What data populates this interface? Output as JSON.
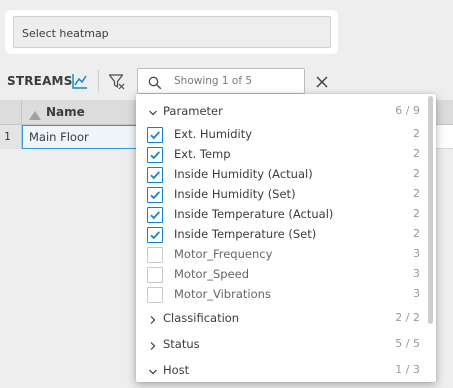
{
  "heatmap": {
    "placeholder": "Select heatmap"
  },
  "toolbar": {
    "streams_label": "STREAMS",
    "chart_icon": "line-chart-icon",
    "filter_icon": "filter-icon",
    "search_placeholder": "Showing 1 of 5",
    "close_icon": "close-icon"
  },
  "grid": {
    "column_name": "Name",
    "rows": [
      {
        "num": "1",
        "name": "Main Floor"
      }
    ]
  },
  "dropdown": {
    "groups": [
      {
        "label": "Parameter",
        "count": "6 / 9",
        "expanded": true,
        "options": [
          {
            "label": "Ext. Humidity",
            "count": "2",
            "checked": true
          },
          {
            "label": "Ext. Temp",
            "count": "2",
            "checked": true
          },
          {
            "label": "Inside Humidity (Actual)",
            "count": "2",
            "checked": true
          },
          {
            "label": "Inside Humidity (Set)",
            "count": "2",
            "checked": true
          },
          {
            "label": "Inside Temperature (Actual)",
            "count": "2",
            "checked": true
          },
          {
            "label": "Inside Temperature (Set)",
            "count": "2",
            "checked": true
          },
          {
            "label": "Motor_Frequency",
            "count": "3",
            "checked": false
          },
          {
            "label": "Motor_Speed",
            "count": "3",
            "checked": false
          },
          {
            "label": "Motor_Vibrations",
            "count": "3",
            "checked": false
          }
        ]
      },
      {
        "label": "Classification",
        "count": "2 / 2",
        "expanded": false
      },
      {
        "label": "Status",
        "count": "5 / 5",
        "expanded": false
      },
      {
        "label": "Host",
        "count": "1 / 3",
        "expanded": false
      }
    ]
  },
  "colors": {
    "accent": "#0e84c9",
    "selection_border": "#3a98d0",
    "background": "#eeeeee"
  }
}
